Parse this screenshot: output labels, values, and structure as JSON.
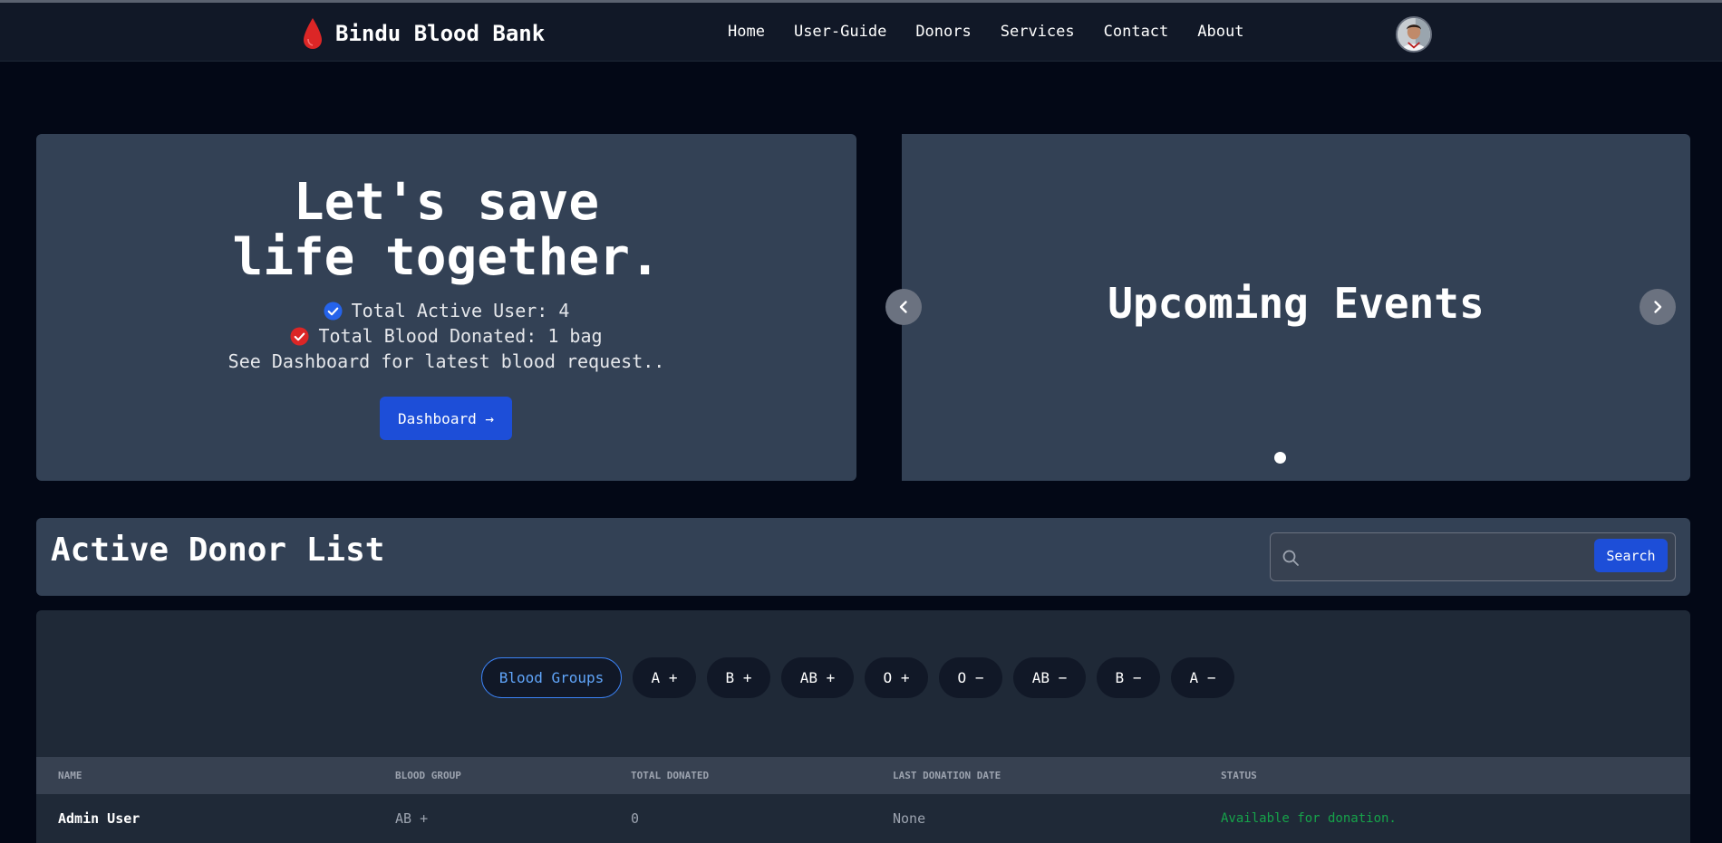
{
  "navbar": {
    "brand": "Bindu Blood Bank",
    "brand_color": "#dc2626",
    "links": [
      "Home",
      "User-Guide",
      "Donors",
      "Services",
      "Contact",
      "About"
    ]
  },
  "hero": {
    "title_line1": "Let's save",
    "title_line2": "life together.",
    "stat_active_users": "Total Active User: 4",
    "stat_blood_donated": "Total Blood Donated: 1 bag",
    "dashboard_note": "See Dashboard for latest blood request..",
    "dashboard_button": "Dashboard →"
  },
  "carousel": {
    "title": "Upcoming Events",
    "slide_count": 1,
    "active_slide": 1
  },
  "donors": {
    "title": "Active Donor List",
    "search_placeholder": "",
    "search_button": "Search",
    "blood_groups": [
      "Blood Groups",
      "A +",
      "B +",
      "AB +",
      "O +",
      "O −",
      "AB −",
      "B −",
      "A −"
    ],
    "table": {
      "headers": [
        "NAME",
        "BLOOD GROUP",
        "TOTAL DONATED",
        "LAST DONATION DATE",
        "STATUS"
      ],
      "rows": [
        [
          "Admin User",
          "AB +",
          "0",
          "None",
          "Available for donation."
        ]
      ]
    }
  },
  "colors": {
    "accent": "#1d4ed8",
    "status_available": "#16a34a",
    "check_blue": "#2563eb",
    "check_red": "#dc2626"
  }
}
